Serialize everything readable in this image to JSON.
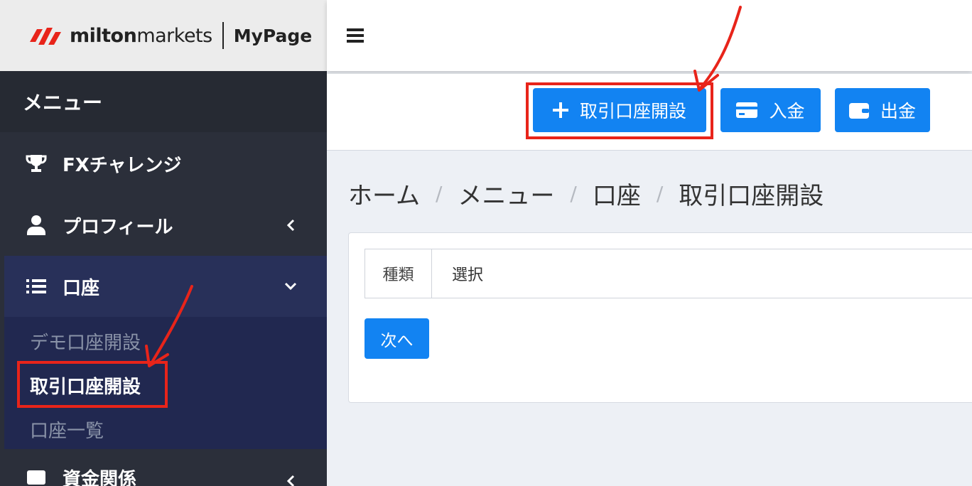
{
  "brand": {
    "name_bold": "milton",
    "name_light": "markets",
    "section": "MyPage"
  },
  "sidebar": {
    "menu_title": "メニュー",
    "items": [
      {
        "label": "FXチャレンジ",
        "icon": "trophy-icon"
      },
      {
        "label": "プロフィール",
        "icon": "user-icon"
      },
      {
        "label": "口座",
        "icon": "list-icon"
      },
      {
        "label": "資金関係",
        "icon": "wallet-icon"
      }
    ],
    "account_submenu": [
      "デモ口座開設",
      "取引口座開設",
      "口座一覧"
    ]
  },
  "actions": {
    "open_account": "取引口座開設",
    "deposit": "入金",
    "withdraw": "出金"
  },
  "breadcrumb": [
    "ホーム",
    "メニュー",
    "口座",
    "取引口座開設"
  ],
  "form": {
    "type_label": "種類",
    "type_value": "選択",
    "next_button": "次へ"
  },
  "colors": {
    "accent": "#1283f2",
    "highlight": "#e8241a",
    "sidebar": "#2b2f3a",
    "active": "#283059"
  }
}
